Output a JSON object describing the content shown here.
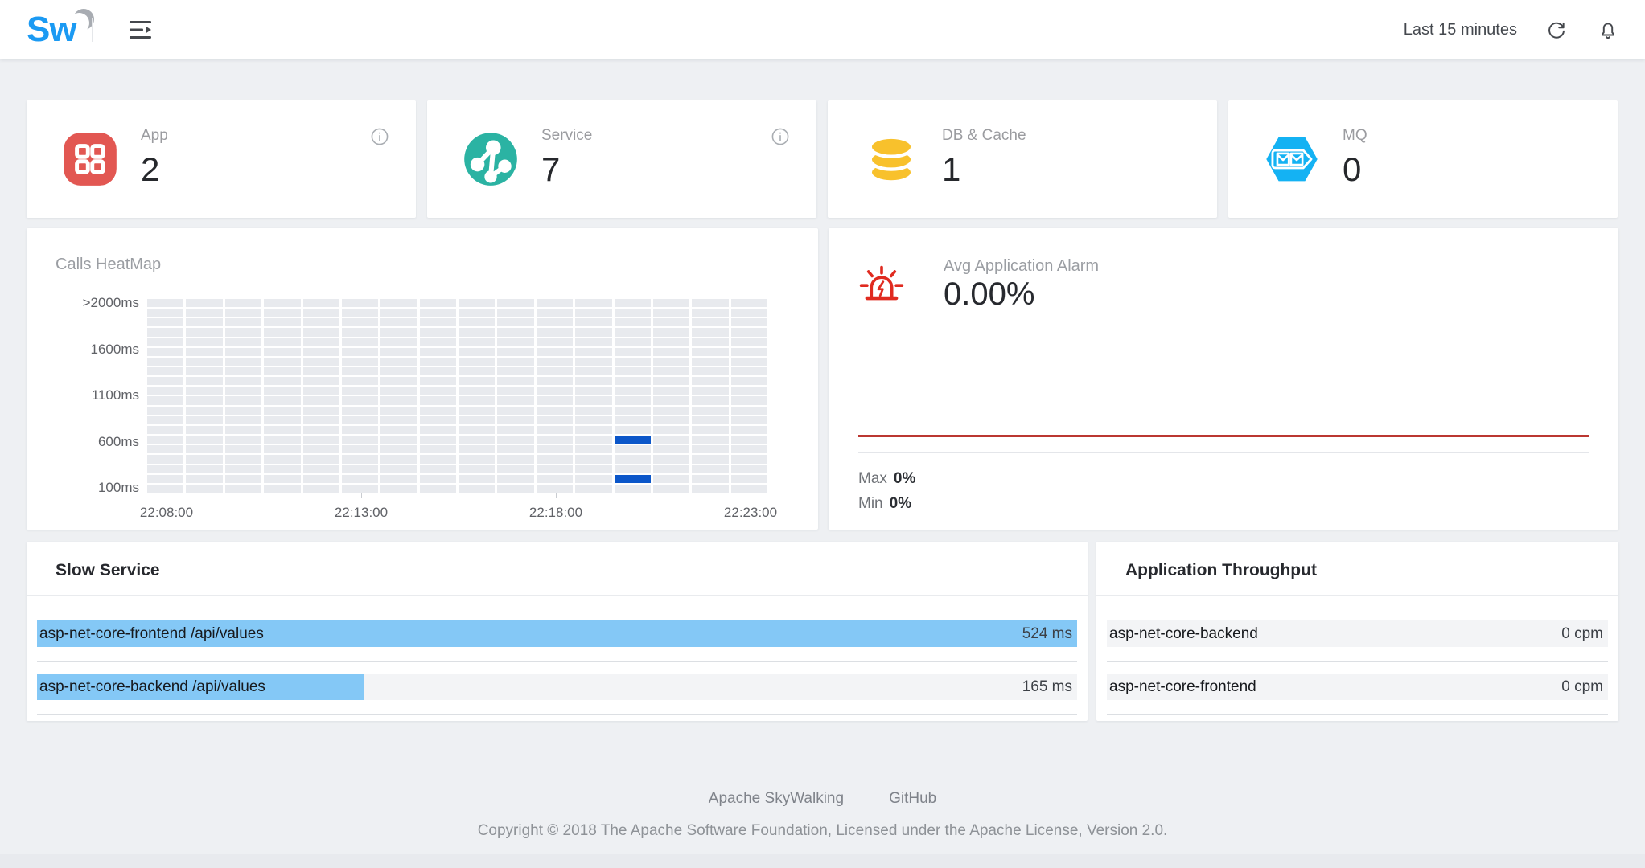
{
  "header": {
    "logo": "Sw",
    "menu_icon": "menu-fold-icon",
    "time_range": "Last 15 minutes",
    "refresh_icon": "refresh-icon",
    "notifications_icon": "bell-icon"
  },
  "stat_cards": [
    {
      "label": "App",
      "value": "2",
      "icon": "app-grid-icon",
      "icon_color": "#e25752",
      "has_info": true
    },
    {
      "label": "Service",
      "value": "7",
      "icon": "service-topology-icon",
      "icon_color": "#2bb3a3",
      "has_info": true
    },
    {
      "label": "DB & Cache",
      "value": "1",
      "icon": "database-icon",
      "icon_color": "#f8c12c",
      "has_info": false
    },
    {
      "label": "MQ",
      "value": "0",
      "icon": "message-queue-icon",
      "icon_color": "#14b2f3",
      "has_info": false
    }
  ],
  "heatmap": {
    "title": "Calls HeatMap",
    "y_axis_labels": [
      ">2000ms",
      "1600ms",
      "1100ms",
      "600ms",
      "100ms"
    ],
    "x_axis_labels": [
      "22:08:00",
      "22:13:00",
      "22:18:00",
      "22:23:00"
    ],
    "grid": {
      "columns": 16,
      "rows": 20
    },
    "active_cells": [
      {
        "column": 12,
        "row_from_bottom": 5,
        "bucket": "600ms"
      },
      {
        "column": 12,
        "row_from_bottom": 1,
        "bucket": "200ms"
      }
    ],
    "colors": {
      "cell": "#e8eaee",
      "active": "#0b56c9"
    }
  },
  "alarm": {
    "icon": "alarm-siren-icon",
    "title": "Avg Application Alarm",
    "value": "0.00%",
    "max_label": "Max",
    "max_value": "0%",
    "min_label": "Min",
    "min_value": "0%",
    "line_color": "#bb3731"
  },
  "slow_service": {
    "title": "Slow Service",
    "rows": [
      {
        "label": "asp-net-core-frontend /api/values",
        "value": "524 ms",
        "percent": 100
      },
      {
        "label": "asp-net-core-backend /api/values",
        "value": "165 ms",
        "percent": 31.5
      }
    ],
    "bar_color": "#84c8f6"
  },
  "throughput": {
    "title": "Application Throughput",
    "rows": [
      {
        "label": "asp-net-core-backend",
        "value": "0 cpm",
        "percent": 0
      },
      {
        "label": "asp-net-core-frontend",
        "value": "0 cpm",
        "percent": 0
      }
    ]
  },
  "footer": {
    "links": [
      {
        "label": "Apache SkyWalking"
      },
      {
        "label": "GitHub"
      }
    ],
    "copyright": "Copyright © 2018 The Apache Software Foundation, Licensed under the Apache License, Version 2.0."
  },
  "chart_data": [
    {
      "type": "heatmap",
      "title": "Calls HeatMap",
      "x": [
        "22:08:00",
        "22:13:00",
        "22:18:00",
        "22:23:00"
      ],
      "y": [
        "100ms",
        "600ms",
        "1100ms",
        "1600ms",
        ">2000ms"
      ],
      "points": [
        {
          "time": "22:20:00",
          "bucket": "600ms",
          "active": true
        },
        {
          "time": "22:20:00",
          "bucket": "200ms",
          "active": true
        }
      ],
      "legend_position": "none",
      "grid": true
    },
    {
      "type": "line",
      "title": "Avg Application Alarm",
      "series": [
        {
          "name": "alarm-percentage",
          "values": [
            0,
            0
          ]
        }
      ],
      "ylabel": "%",
      "ylim": [
        0,
        0
      ],
      "annotations": [
        "Max 0%",
        "Min 0%"
      ]
    },
    {
      "type": "bar",
      "title": "Slow Service",
      "categories": [
        "asp-net-core-frontend /api/values",
        "asp-net-core-backend /api/values"
      ],
      "values": [
        524,
        165
      ],
      "ylabel": "ms",
      "xlim": [
        0,
        524
      ]
    },
    {
      "type": "bar",
      "title": "Application Throughput",
      "categories": [
        "asp-net-core-backend",
        "asp-net-core-frontend"
      ],
      "values": [
        0,
        0
      ],
      "ylabel": "cpm",
      "xlim": [
        0,
        0
      ]
    }
  ]
}
